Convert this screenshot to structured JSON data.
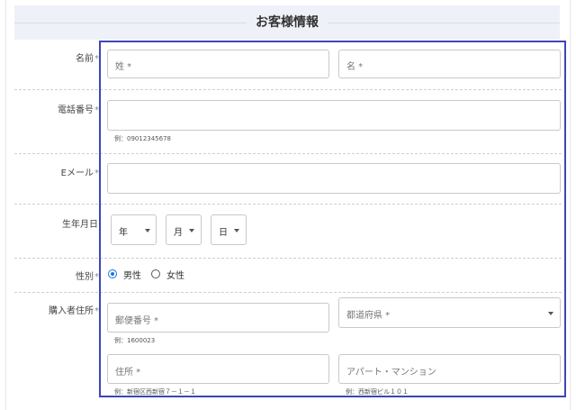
{
  "section": {
    "title": "お客様情報"
  },
  "required_mark": "*",
  "name": {
    "label": "名前",
    "last_placeholder": "姓 *",
    "first_placeholder": "名 *"
  },
  "phone": {
    "label": "電話番号",
    "hint": "例：09012345678"
  },
  "email": {
    "label": "Eメール"
  },
  "birthdate": {
    "label": "生年月日",
    "year": "年",
    "month": "月",
    "day": "日"
  },
  "gender": {
    "label": "性別",
    "options": [
      {
        "label": "男性",
        "selected": true
      },
      {
        "label": "女性",
        "selected": false
      }
    ]
  },
  "address": {
    "label": "購入者住所",
    "postal_placeholder": "郵便番号 *",
    "postal_hint": "例：1600023",
    "prefecture_placeholder": "都道府県 *",
    "street_placeholder": "住所 *",
    "street_hint": "例：新宿区西新宿７－１－１",
    "building_placeholder": "アパート・マンション",
    "building_hint": "例：西新宿ビル１０１"
  },
  "colors": {
    "highlight": "#3d45b8",
    "radio_selected": "#1a73e8",
    "header_bg": "#eef1f8"
  }
}
